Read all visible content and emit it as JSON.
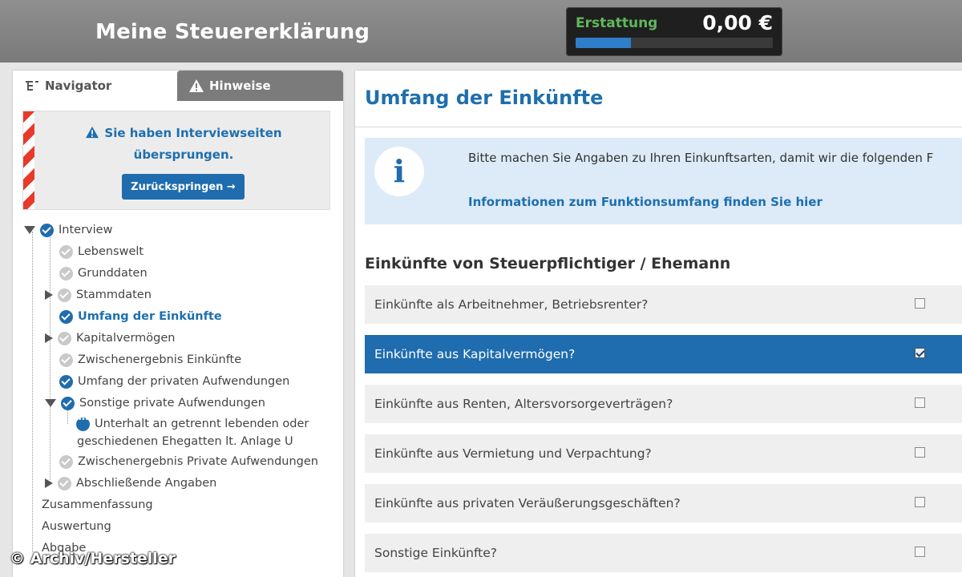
{
  "header": {
    "app_title": "Meine Steuererklärung",
    "refund_label": "Erstattung",
    "refund_amount": "0,00 €",
    "refund_progress": 0.28
  },
  "left_panel": {
    "tabs": [
      {
        "label": "Navigator",
        "icon": "navigator-tree-icon",
        "active": true
      },
      {
        "label": "Hinweise",
        "icon": "warning-icon",
        "active": false
      }
    ],
    "notice": {
      "line1": "Sie haben Interviewseiten",
      "line2": "übersprungen.",
      "button_label": "Zurückspringen →"
    },
    "tree": [
      {
        "label": "Interview",
        "status": "done",
        "expander": "expanded"
      },
      {
        "label": "Lebenswelt",
        "status": "todo",
        "expander": "none"
      },
      {
        "label": "Grunddaten",
        "status": "todo",
        "expander": "none"
      },
      {
        "label": "Stammdaten",
        "status": "todo",
        "expander": "collapsed"
      },
      {
        "label": "Umfang der Einkünfte",
        "status": "done",
        "expander": "none",
        "active": true
      },
      {
        "label": "Kapitalvermögen",
        "status": "todo",
        "expander": "collapsed"
      },
      {
        "label": "Zwischenergebnis Einkünfte",
        "status": "todo",
        "expander": "none"
      },
      {
        "label": "Umfang der privaten Aufwendungen",
        "status": "done",
        "expander": "none"
      },
      {
        "label": "Sonstige private Aufwendungen",
        "status": "done",
        "expander": "expanded"
      },
      {
        "label": "Unterhalt an getrennt lebenden oder",
        "status": "pending",
        "expander": "none"
      },
      {
        "label": "geschiedenen Ehegatten lt. Anlage U",
        "status": "none",
        "expander": "none"
      },
      {
        "label": "Zwischenergebnis Private Aufwendungen",
        "status": "todo",
        "expander": "none"
      },
      {
        "label": "Abschließende Angaben",
        "status": "todo",
        "expander": "collapsed"
      },
      {
        "label": "Zusammenfassung",
        "status": "none",
        "expander": "none"
      },
      {
        "label": "Auswertung",
        "status": "none",
        "expander": "none"
      },
      {
        "label": "Abgabe",
        "status": "none",
        "expander": "none"
      }
    ]
  },
  "main": {
    "page_title": "Umfang der Einkünfte",
    "info_text": "Bitte machen Sie Angaben zu Ihren Einkunftsarten, damit wir die folgenden F",
    "info_link": "Informationen zum Funktionsumfang finden Sie hier",
    "section_title": "Einkünfte von Steuerpflichtiger / Ehemann",
    "questions": [
      {
        "label": "Einkünfte als Arbeitnehmer, Betriebsrenter?",
        "checked": false,
        "selected": false
      },
      {
        "label": "Einkünfte aus Kapitalvermögen?",
        "checked": true,
        "selected": true
      },
      {
        "label": "Einkünfte aus Renten, Altersvorsorgeverträgen?",
        "checked": false,
        "selected": false
      },
      {
        "label": "Einkünfte aus Vermietung und Verpachtung?",
        "checked": false,
        "selected": false
      },
      {
        "label": "Einkünfte aus privaten Veräußerungsgeschäften?",
        "checked": false,
        "selected": false
      },
      {
        "label": "Sonstige Einkünfte?",
        "checked": false,
        "selected": false
      }
    ]
  },
  "watermark": "© Archiv/Hersteller",
  "colors": {
    "accent": "#1f6cae",
    "refund_green": "#5fb85a",
    "topbar": "#808080",
    "stripe_red": "#e8392b"
  }
}
